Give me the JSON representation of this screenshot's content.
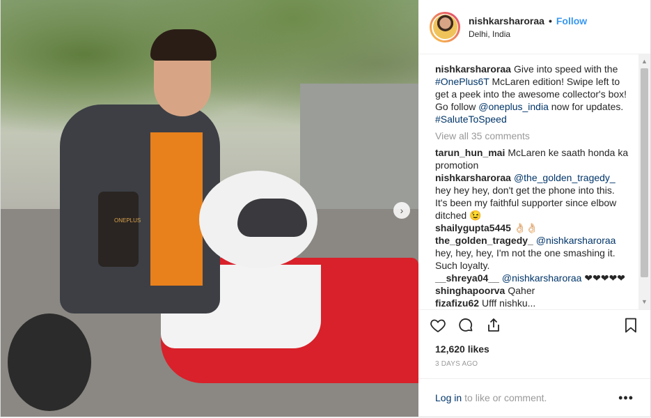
{
  "post": {
    "username": "nishkarsharoraa",
    "follow_label": "Follow",
    "separator": "•",
    "location": "Delhi, India",
    "photo_brand_text": "ONEPLUS"
  },
  "caption": {
    "username": "nishkarsharoraa",
    "text_1": "Give into speed with the ",
    "hashtag_1": "#OnePlus6T",
    "text_2": " McLaren edition! Swipe left to get a peek into the awesome collector's box! Go follow ",
    "mention_1": "@oneplus_india",
    "text_3": " now for updates. ",
    "hashtag_2": "#SaluteToSpeed"
  },
  "view_all_label": "View all 35 comments",
  "comments": [
    {
      "username": "tarun_hun_mai",
      "mention": "",
      "text": "McLaren ke saath honda ka promotion"
    },
    {
      "username": "nishkarsharoraa",
      "mention": "@the_golden_tragedy_",
      "text": "hey hey hey, don't get the phone into this. It's been my faithful supporter since elbow ditched 😉"
    },
    {
      "username": "shailygupta5445",
      "mention": "",
      "text": "👌🏻👌🏻"
    },
    {
      "username": "the_golden_tragedy_",
      "mention": "@nishkarsharoraa",
      "text": "hey, hey, hey, I'm not the one smashing it. Such loyalty."
    },
    {
      "username": "__shreya04__",
      "mention": "@nishkarsharoraa",
      "text": "❤❤❤❤❤"
    },
    {
      "username": "shinghapoorva",
      "mention": "",
      "text": "Qaher"
    },
    {
      "username": "fizafizu62",
      "mention": "",
      "text": "Ufff nishku..."
    }
  ],
  "likes": "12,620 likes",
  "time_ago": "3 DAYS AGO",
  "login": {
    "link_label": "Log in",
    "rest_label": "to like or comment.",
    "more_label": "•••"
  }
}
